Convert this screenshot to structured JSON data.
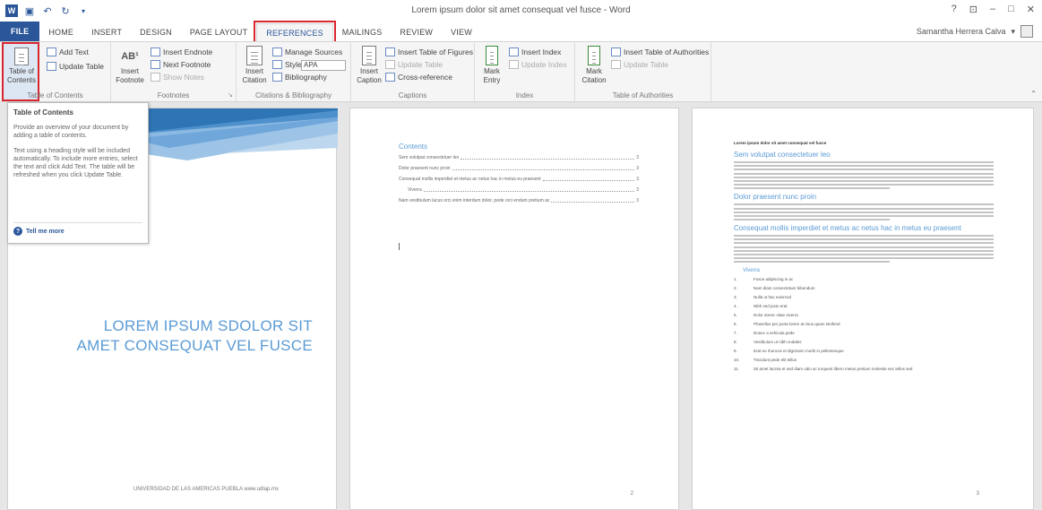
{
  "window": {
    "title": "Lorem ipsum dolor sit amet consequat vel fusce - Word",
    "controls": [
      "?",
      "⊡",
      "–",
      "□",
      "✕"
    ]
  },
  "qat": {
    "app_icon": "W"
  },
  "account": {
    "name": "Samantha Herrera Calva"
  },
  "tabs": [
    "FILE",
    "HOME",
    "INSERT",
    "DESIGN",
    "PAGE LAYOUT",
    "REFERENCES",
    "MAILINGS",
    "REVIEW",
    "VIEW"
  ],
  "ribbon": {
    "toc": {
      "toc_label": "Table of Contents",
      "add_text": "Add Text",
      "update_table": "Update Table",
      "group": "Table of Contents"
    },
    "footnotes": {
      "insert_footnote": "Insert Footnote",
      "insert_endnote": "Insert Endnote",
      "next_footnote": "Next Footnote",
      "show_notes": "Show Notes",
      "group": "Footnotes",
      "ab_mark": "AB¹"
    },
    "citations": {
      "insert_citation": "Insert Citation",
      "manage_sources": "Manage Sources",
      "style_label": "Style:",
      "style_value": "APA",
      "bibliography": "Bibliography",
      "group": "Citations & Bibliography"
    },
    "captions": {
      "insert_caption": "Insert Caption",
      "insert_table_of_figures": "Insert Table of Figures",
      "update_table": "Update Table",
      "cross_reference": "Cross-reference",
      "group": "Captions"
    },
    "index": {
      "mark_entry": "Mark Entry",
      "insert_index": "Insert Index",
      "update_index": "Update Index",
      "group": "Index"
    },
    "authorities": {
      "mark_citation": "Mark Citation",
      "insert_table_of_authorities": "Insert Table of Authorities",
      "update_table": "Update Table",
      "group": "Table of Authorities"
    }
  },
  "tooltip": {
    "title": "Table of Contents",
    "p1": "Provide an overview of your document by adding a table of contents.",
    "p2": "Text using a heading style will be included automatically. To include more entries, select the text and click Add Text. The table will be refreshed when you click Update Table.",
    "tell_more": "Tell me more"
  },
  "page1": {
    "title_line1": "LOREM IPSUM SDOLOR SIT",
    "title_line2": "AMET CONSEQUAT VEL FUSCE",
    "footer": "UNIVERSIDAD DE LAS AMERICAS PUEBLA www.udlap.mx"
  },
  "page2": {
    "toc_heading": "Contents",
    "entries": [
      {
        "text": "Sem volutpat consectetuer leo",
        "page": "3"
      },
      {
        "text": "Dolor praesent nunc proin",
        "page": "3"
      },
      {
        "text": "Consequat mollis imperdiet et metus ac netus hac in metus eu praesent",
        "page": "3"
      },
      {
        "text": "Viverra",
        "page": "3"
      },
      {
        "text": "Nam vestibulum lacus orci enim interdum dolor, pede orci endum pretium ac",
        "page": "3"
      }
    ],
    "page_number": "2"
  },
  "page3": {
    "doc_title": "Lorem ipsum dolor sit amet consequat vel fusce",
    "h1": "Sem volutpat consectetuer leo",
    "h2": "Dolor praesent nunc proin",
    "h3": "Consequat mollis imperdiet et metus ac netus hac in metus eu praesent",
    "h4": "Viverra",
    "list": [
      "Fusce adipiscing in ac",
      "Nam diam consectetuer bibendum",
      "Nulla ut hac euismod",
      "Nibh sed justo erat",
      "Dolor donec vitae viverra",
      "Phasellus per porta lorem at risus quam eleifend",
      "Donec a vehicula pede",
      "Vestibulum ut nibh sodales",
      "Erat eu rhoncus et dignissim morbi in pellentesque",
      "Tincidunt pede elit tellus",
      "Sit amet lacinia et sed diam odio ac torquent libero metus pretium molestie nec tellus sed"
    ],
    "page_number": "3"
  },
  "colors": {
    "accent": "#2b579a",
    "highlight": "#d8262e",
    "heading": "#5b9bd5"
  }
}
